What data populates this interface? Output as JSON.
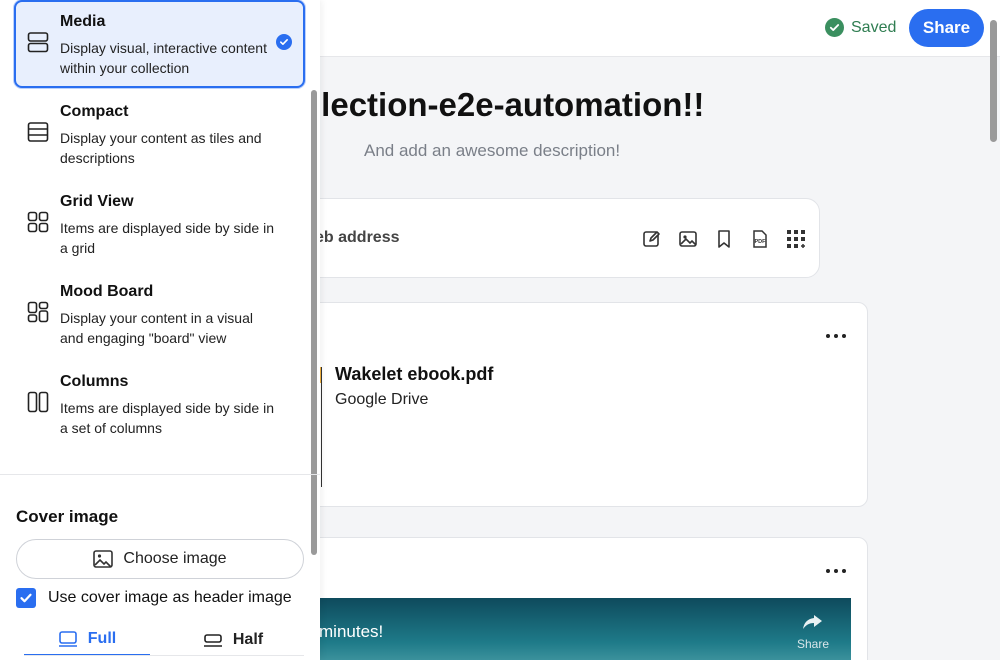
{
  "topbar": {
    "saved_label": "Saved",
    "share_label": "Share"
  },
  "collection": {
    "title": "llection-e2e-automation!!",
    "description": "And add an awesome description!",
    "add_placeholder": "eb address",
    "tools": [
      "edit-icon",
      "image-icon",
      "bookmark-icon",
      "pdf-icon",
      "grid-plus-icon"
    ]
  },
  "cards": [
    {
      "title": "Wakelet ebook.pdf",
      "source": "Google Drive"
    },
    {
      "video_text": "minutes!",
      "video_share": "Share"
    }
  ],
  "layout_panel": {
    "options": [
      {
        "name": "Media",
        "description": "Display visual, interactive content within your collection",
        "selected": true,
        "icon": "media-layout-icon"
      },
      {
        "name": "Compact",
        "description": "Display your content as tiles and descriptions",
        "selected": false,
        "icon": "compact-layout-icon"
      },
      {
        "name": "Grid View",
        "description": "Items are displayed side by side in a grid",
        "selected": false,
        "icon": "grid-layout-icon"
      },
      {
        "name": "Mood Board",
        "description": "Display your content in a visual and engaging \"board\" view",
        "selected": false,
        "icon": "moodboard-layout-icon"
      },
      {
        "name": "Columns",
        "description": "Items are displayed side by side in a set of columns",
        "selected": false,
        "icon": "columns-layout-icon"
      }
    ],
    "cover_heading": "Cover image",
    "choose_image_label": "Choose image",
    "use_cover_label": "Use cover image as header image",
    "use_cover_checked": true,
    "size_options": [
      "Full",
      "Half"
    ],
    "size_selected": "Full"
  },
  "colors": {
    "accent": "#2a6ef0",
    "saved_green": "#2f7d51",
    "selected_bg": "#e8effd"
  }
}
